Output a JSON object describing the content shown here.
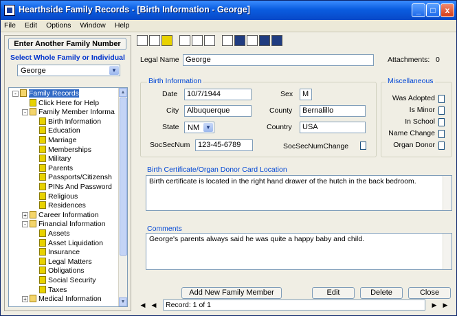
{
  "window": {
    "title": "Hearthside Family Records - [Birth Information - George]",
    "controls": {
      "minimize": "_",
      "maximize": "□",
      "close": "x"
    }
  },
  "menu": [
    "File",
    "Edit",
    "Options",
    "Window",
    "Help"
  ],
  "left": {
    "enter_button": "Enter Another Family Number",
    "select_label": "Select Whole Family or Individual",
    "individual": "George",
    "tree": [
      {
        "label": "Family Records",
        "level": 0,
        "type": "folder",
        "selected": true,
        "expander": "-"
      },
      {
        "label": "Click Here for Help",
        "level": 1,
        "type": "doc"
      },
      {
        "label": "Family Member Informa",
        "level": 1,
        "type": "folder",
        "expander": "-"
      },
      {
        "label": "Birth Information",
        "level": 2,
        "type": "doc"
      },
      {
        "label": "Education",
        "level": 2,
        "type": "doc"
      },
      {
        "label": "Marriage",
        "level": 2,
        "type": "doc"
      },
      {
        "label": "Memberships",
        "level": 2,
        "type": "doc"
      },
      {
        "label": "Military",
        "level": 2,
        "type": "doc"
      },
      {
        "label": "Parents",
        "level": 2,
        "type": "doc"
      },
      {
        "label": "Passports/Citizensh",
        "level": 2,
        "type": "doc"
      },
      {
        "label": "PINs And Password",
        "level": 2,
        "type": "doc"
      },
      {
        "label": "Religious",
        "level": 2,
        "type": "doc"
      },
      {
        "label": "Residences",
        "level": 2,
        "type": "doc"
      },
      {
        "label": "Career Information",
        "level": 1,
        "type": "folder",
        "expander": "+"
      },
      {
        "label": "Financial Information",
        "level": 1,
        "type": "folder",
        "expander": "-"
      },
      {
        "label": "Assets",
        "level": 2,
        "type": "doc"
      },
      {
        "label": "Asset Liquidation",
        "level": 2,
        "type": "doc"
      },
      {
        "label": "Insurance",
        "level": 2,
        "type": "doc"
      },
      {
        "label": "Legal Matters",
        "level": 2,
        "type": "doc"
      },
      {
        "label": "Obligations",
        "level": 2,
        "type": "doc"
      },
      {
        "label": "Social Security",
        "level": 2,
        "type": "doc"
      },
      {
        "label": "Taxes",
        "level": 2,
        "type": "doc"
      },
      {
        "label": "Medical Information",
        "level": 1,
        "type": "folder",
        "expander": "+"
      }
    ]
  },
  "form": {
    "legal_name_label": "Legal Name",
    "legal_name_value": "George",
    "attachments_label": "Attachments:",
    "attachments_value": "0",
    "birth_group_title": "Birth Information",
    "date_label": "Date",
    "date_value": "10/7/1944",
    "sex_label": "Sex",
    "sex_value": "M",
    "city_label": "City",
    "city_value": "Albuquerque",
    "county_label": "County",
    "county_value": "Bernalillo",
    "state_label": "State",
    "state_value": "NM",
    "country_label": "Country",
    "country_value": "USA",
    "socsec_label": "SocSecNum",
    "socsec_value": "123-45-6789",
    "socsec_change_label": "SocSecNumChange",
    "misc_group_title": "Miscellaneous",
    "misc": [
      {
        "label": "Was Adopted",
        "checked": false
      },
      {
        "label": "Is Minor",
        "checked": false
      },
      {
        "label": "In School",
        "checked": false
      },
      {
        "label": "Name Change",
        "checked": false
      },
      {
        "label": "Organ Donor",
        "checked": false
      }
    ],
    "location_label": "Birth Certificate/Organ Donor Card Location",
    "location_value": "Birth certificate is located in the right hand drawer of the hutch in the back bedroom.",
    "comments_label": "Comments",
    "comments_value": "George's parents always said he was quite a happy baby and child."
  },
  "actions": {
    "add_new": "Add New Family Member",
    "edit": "Edit",
    "delete": "Delete",
    "close": "Close"
  },
  "navigation": {
    "record_text": "Record: 1 of 1"
  },
  "colors": {
    "title_bar": "#0a5de0",
    "group_title": "#0046d5",
    "selected": "#316ac5"
  }
}
